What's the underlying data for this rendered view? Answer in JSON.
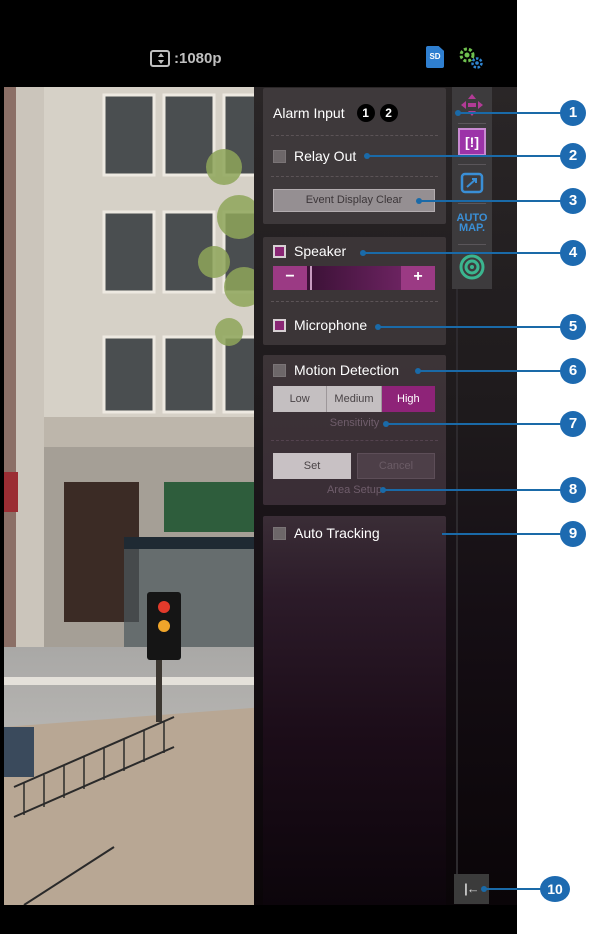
{
  "topbar": {
    "resolution_label": ":1080p",
    "sd_label": "SD"
  },
  "alarm": {
    "alarm_input_label": "Alarm Input",
    "alarm_input_1": "1",
    "alarm_input_2": "2",
    "relay_out_label": "Relay Out",
    "relay_out_checked": false,
    "event_clear_label": "Event Display Clear"
  },
  "audio": {
    "speaker_label": "Speaker",
    "speaker_checked": true,
    "volume_minus": "−",
    "volume_plus": "+",
    "volume_level": 0.03,
    "microphone_label": "Microphone",
    "microphone_checked": true
  },
  "motion": {
    "label": "Motion Detection",
    "checked": false,
    "sensitivity_options": [
      "Low",
      "Medium",
      "High"
    ],
    "sensitivity_selected": "High",
    "sensitivity_caption": "Sensitivity",
    "set_label": "Set",
    "cancel_label": "Cancel",
    "area_caption": "Area Setup"
  },
  "tracking": {
    "label": "Auto Tracking",
    "checked": false
  },
  "toolbar": {
    "items": [
      {
        "icon": "ptz-move-icon"
      },
      {
        "icon": "alarm-event-icon"
      },
      {
        "icon": "preset-zoom-icon"
      },
      {
        "icon": "auto-map-icon",
        "text": "AUTO\nMAP."
      },
      {
        "icon": "camera-lens-icon"
      }
    ],
    "auto_map_line1": "AUTO",
    "auto_map_line2": "MAP.",
    "collapse_label": "|←"
  },
  "callouts": [
    "1",
    "2",
    "3",
    "4",
    "5",
    "6",
    "7",
    "8",
    "9",
    "10"
  ],
  "colors": {
    "accent": "#8e2378",
    "callout": "#1d6ab0",
    "panel": "#3e393b"
  }
}
